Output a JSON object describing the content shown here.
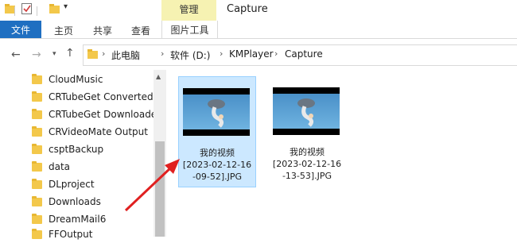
{
  "window": {
    "title": "Capture",
    "context_group": "管理"
  },
  "ribbon": {
    "file_tab": "文件",
    "tabs": [
      "主页",
      "共享",
      "查看"
    ],
    "context_tab": "图片工具"
  },
  "address": {
    "crumbs": [
      "此电脑",
      "软件 (D:)",
      "KMPlayer",
      "Capture"
    ]
  },
  "nav": {
    "items": [
      "CloudMusic",
      "CRTubeGet Converted",
      "CRTubeGet Downloaded",
      "CRVideoMate Output",
      "csptBackup",
      "data",
      "DLproject",
      "Downloads",
      "DreamMail6",
      "FFOutput"
    ]
  },
  "files": [
    {
      "line1": "我的视频",
      "line2": "[2023-02-12-16",
      "line3": "-09-52].JPG",
      "selected": true
    },
    {
      "line1": "我的视频",
      "line2": "[2023-02-12-16",
      "line3": "-13-53].JPG",
      "selected": false
    }
  ],
  "colors": {
    "accent": "#1f6fc1",
    "context_highlight": "#f6f2b2",
    "selection": "#cce8ff",
    "annotation_arrow": "#e02020"
  }
}
